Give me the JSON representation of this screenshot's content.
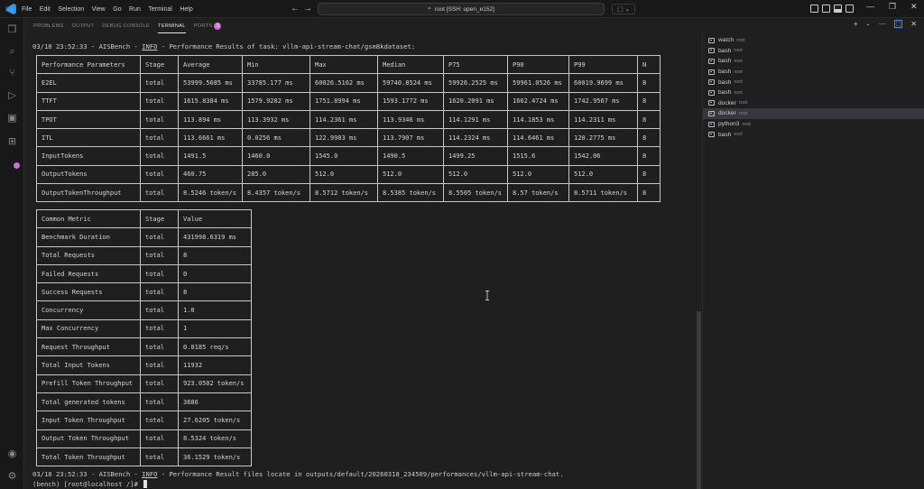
{
  "menu": [
    "File",
    "Edit",
    "Selection",
    "View",
    "Go",
    "Run",
    "Terminal",
    "Help"
  ],
  "command_center": {
    "text": "root [SSH: open_e152]"
  },
  "panel": {
    "tabs": [
      "PROBLEMS",
      "OUTPUT",
      "DEBUG CONSOLE",
      "TERMINAL",
      "PORTS"
    ],
    "active_tab": "TERMINAL",
    "ports_count": "3"
  },
  "terminal": {
    "log_start": "03/18 23:52:33 - AISBench - ",
    "log_level": "INFO",
    "log_msg1": " - Performance Results of task: vllm-api-stream-chat/gsm8kdataset:",
    "log_msg2": " - Performance Result files locate in outputs/default/20260318_234509/performances/vllm-api-stream-chat.",
    "prompt": "(bench) [root@localhost /]# "
  },
  "perf_table": {
    "headers": [
      "Performance Parameters",
      "Stage",
      "Average",
      "Min",
      "Max",
      "Median",
      "P75",
      "P90",
      "P99",
      "N"
    ],
    "rows": [
      [
        "E2EL",
        "total",
        "53999.5685 ms",
        "33785.177 ms",
        "60026.5162 ms",
        "59740.8524 ms",
        "59926.2525 ms",
        "59961.0526 ms",
        "60019.9699 ms",
        "8"
      ],
      [
        "TTFT",
        "total",
        "1615.8384 ms",
        "1579.9282 ms",
        "1751.8994 ms",
        "1593.1772 ms",
        "1620.2091 ms",
        "1662.4724 ms",
        "1742.9567 ms",
        "8"
      ],
      [
        "TPOT",
        "total",
        "113.894 ms",
        "113.3932 ms",
        "114.2361 ms",
        "113.9346 ms",
        "114.1291 ms",
        "114.1853 ms",
        "114.2311 ms",
        "8"
      ],
      [
        "ITL",
        "total",
        "113.6661 ms",
        "0.0256 ms",
        "122.9983 ms",
        "113.7907 ms",
        "114.2324 ms",
        "114.6461 ms",
        "120.2775 ms",
        "8"
      ],
      [
        "InputTokens",
        "total",
        "1491.5",
        "1460.0",
        "1545.0",
        "1490.5",
        "1499.25",
        "1515.6",
        "1542.06",
        "8"
      ],
      [
        "OutputTokens",
        "total",
        "460.75",
        "285.0",
        "512.0",
        "512.0",
        "512.0",
        "512.0",
        "512.0",
        "8"
      ],
      [
        "OutputTokenThroughput",
        "total",
        "8.5246 token/s",
        "8.4357 token/s",
        "8.5712 token/s",
        "8.5385 token/s",
        "8.5505 token/s",
        "8.57 token/s",
        "8.5711 token/s",
        "8"
      ]
    ]
  },
  "metric_table": {
    "headers": [
      "Common Metric",
      "Stage",
      "Value"
    ],
    "rows": [
      [
        "Benchmark Duration",
        "total",
        "431998.6319 ms"
      ],
      [
        "Total Requests",
        "total",
        "8"
      ],
      [
        "Failed Requests",
        "total",
        "0"
      ],
      [
        "Success Requests",
        "total",
        "8"
      ],
      [
        "Concurrency",
        "total",
        "1.0"
      ],
      [
        "Max Concurrency",
        "total",
        "1"
      ],
      [
        "Request Throughput",
        "total",
        "0.0185 req/s"
      ],
      [
        "Total Input Tokens",
        "total",
        "11932"
      ],
      [
        "Prefill Token Throughput",
        "total",
        "923.0502 token/s"
      ],
      [
        "Total generated tokens",
        "total",
        "3686"
      ],
      [
        "Input Token Throughput",
        "total",
        "27.6205 token/s"
      ],
      [
        "Output Token Throughput",
        "total",
        "8.5324 token/s"
      ],
      [
        "Total Token Throughput",
        "total",
        "36.1529 token/s"
      ]
    ]
  },
  "terminal_list": {
    "selected_index": 7,
    "items": [
      {
        "name": "watch",
        "sub": "root"
      },
      {
        "name": "bash",
        "sub": "root"
      },
      {
        "name": "bash",
        "sub": "root"
      },
      {
        "name": "bash",
        "sub": "root"
      },
      {
        "name": "bash",
        "sub": "root"
      },
      {
        "name": "bash",
        "sub": "root"
      },
      {
        "name": "docker",
        "sub": "root"
      },
      {
        "name": "docker",
        "sub": "root"
      },
      {
        "name": "python3",
        "sub": "root"
      },
      {
        "name": "bash",
        "sub": "root"
      }
    ]
  },
  "colors": {
    "accent_badge": "#d16bd5",
    "background": "#1f1f1f",
    "table_border": "#c8c8c8"
  }
}
